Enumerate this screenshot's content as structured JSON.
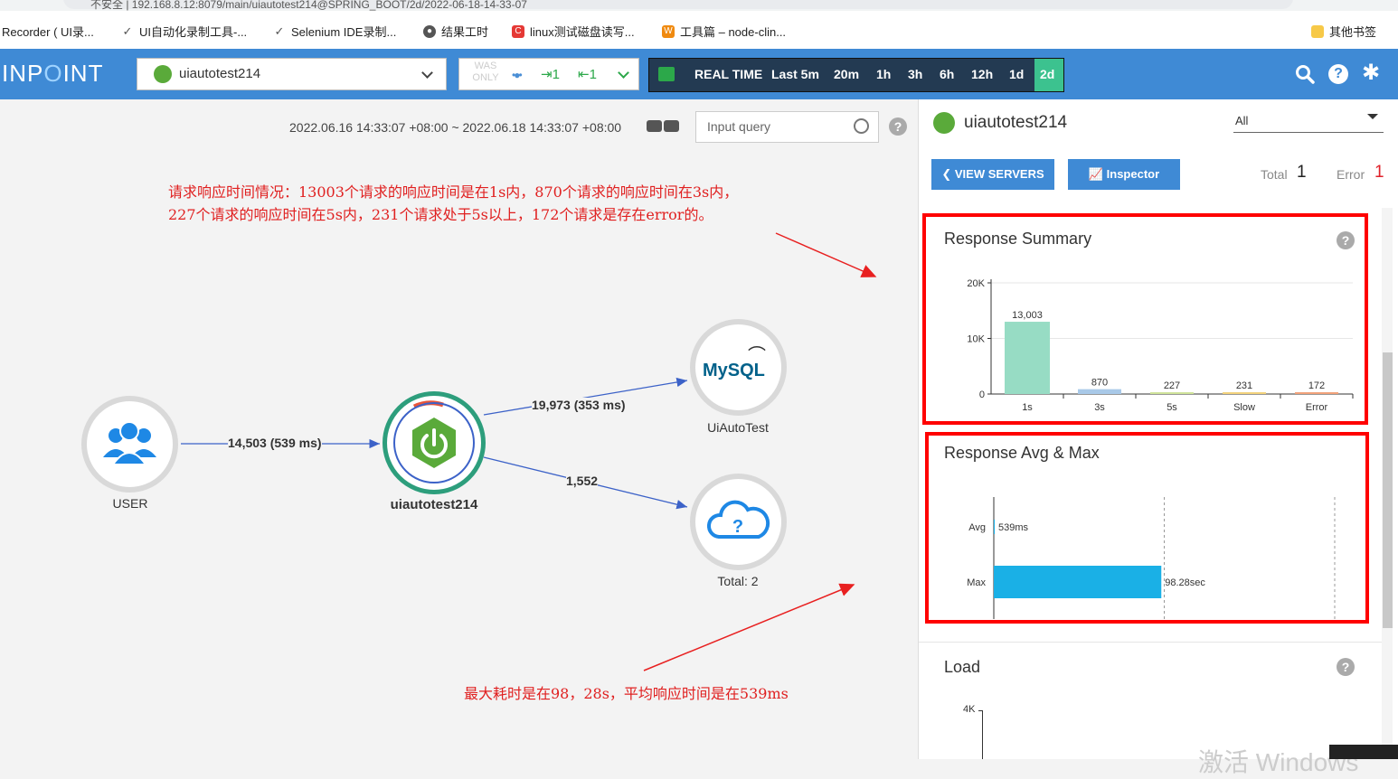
{
  "browser": {
    "url_partial": "不安全 | 192.168.8.12:8079/main/uiautotest214@SPRING_BOOT/2d/2022-06-18-14-33-07",
    "bookmarks": [
      {
        "label": "Recorder ( UI录...",
        "x": 2
      },
      {
        "label": "UI自动化录制工具-...",
        "x": 134
      },
      {
        "label": "Selenium IDE录制...",
        "x": 302
      },
      {
        "label": "结果工时",
        "x": 468
      },
      {
        "label": "linux测试磁盘读写...",
        "x": 566
      },
      {
        "label": "工具篇 – node-clin...",
        "x": 732
      }
    ],
    "other_bookmarks": "其他书签"
  },
  "header": {
    "logo_a": "INP",
    "logo_b": "O",
    "logo_c": "INT",
    "app_name": "uiautotest214",
    "was_only": "WAS ONLY",
    "in_count": "1",
    "out_count": "1",
    "time_buttons": [
      "REAL TIME",
      "Last 5m",
      "20m",
      "1h",
      "3h",
      "6h",
      "12h",
      "1d",
      "2d"
    ],
    "active_time": "2d"
  },
  "main": {
    "date_range": "2022.06.16 14:33:07 +08:00 ~ 2022.06.18 14:33:07 +08:00",
    "query_placeholder": "Input query",
    "note_top_line1": "请求响应时间情况：13003个请求的响应时间是在1s内，870个请求的响应时间在3s内，",
    "note_top_line2": "227个请求的响应时间在5s内，231个请求处于5s以上，172个请求是存在error的。",
    "note_bottom": "最大耗时是在98，28s，平均响应时间是在539ms",
    "nodes": {
      "user": "USER",
      "app": "uiautotest214",
      "mysql_logo": "MySQL",
      "mysql": "UiAutoTest",
      "cloud": "Total: 2"
    },
    "edges": {
      "user_app": "14,503 (539 ms)",
      "app_mysql": "19,973 (353 ms)",
      "app_cloud": "1,552"
    }
  },
  "panel": {
    "title": "uiautotest214",
    "filter": "All",
    "view_servers": "VIEW SERVERS",
    "inspector": "Inspector",
    "total_label": "Total",
    "total_value": "1",
    "error_label": "Error",
    "error_value": "1",
    "card1_title": "Response Summary",
    "card2_title": "Response Avg & Max",
    "card3_title": "Load",
    "load_tick": "4K"
  },
  "chart_data": [
    {
      "type": "bar",
      "title": "Response Summary",
      "categories": [
        "1s",
        "3s",
        "5s",
        "Slow",
        "Error"
      ],
      "values": [
        13003,
        870,
        227,
        231,
        172
      ],
      "data_labels": [
        "13,003",
        "870",
        "227",
        "231",
        "172"
      ],
      "yticks": [
        "0",
        "10K",
        "20K"
      ],
      "ylim": [
        0,
        20000
      ],
      "colors": [
        "#97dcc4",
        "#a9c9e8",
        "#cfe39a",
        "#f3d27c",
        "#f2a27a"
      ]
    },
    {
      "type": "bar",
      "orientation": "horizontal",
      "title": "Response Avg & Max",
      "categories": [
        "Avg",
        "Max"
      ],
      "values": [
        539,
        98280
      ],
      "data_labels": [
        "539ms",
        "98.28sec"
      ],
      "xlim": [
        0,
        200000
      ],
      "colors": [
        "#1ab0e6",
        "#1ab0e6"
      ]
    }
  ]
}
